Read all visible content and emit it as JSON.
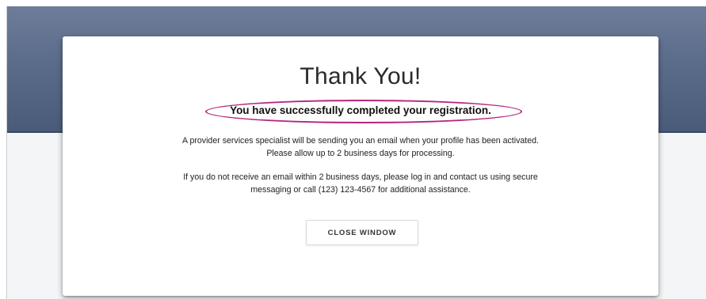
{
  "modal": {
    "title": "Thank You!",
    "subtitle": "You have successfully completed your registration.",
    "paragraph_1_line_1": "A provider services specialist will be sending you an email when your profile has been activated.",
    "paragraph_1_line_2": "Please allow up to 2 business days for processing.",
    "paragraph_2_line_1": "If you do not receive an email within 2 business days, please log in and contact us using secure",
    "paragraph_2_line_2": "messaging or call (123) 123-4567 for additional assistance.",
    "close_button_label": "CLOSE WINDOW"
  },
  "colors": {
    "header_band": "#5b6c8b",
    "highlight_annotation": "#b5267f",
    "modal_background": "#ffffff",
    "page_background": "#f4f5f7"
  }
}
